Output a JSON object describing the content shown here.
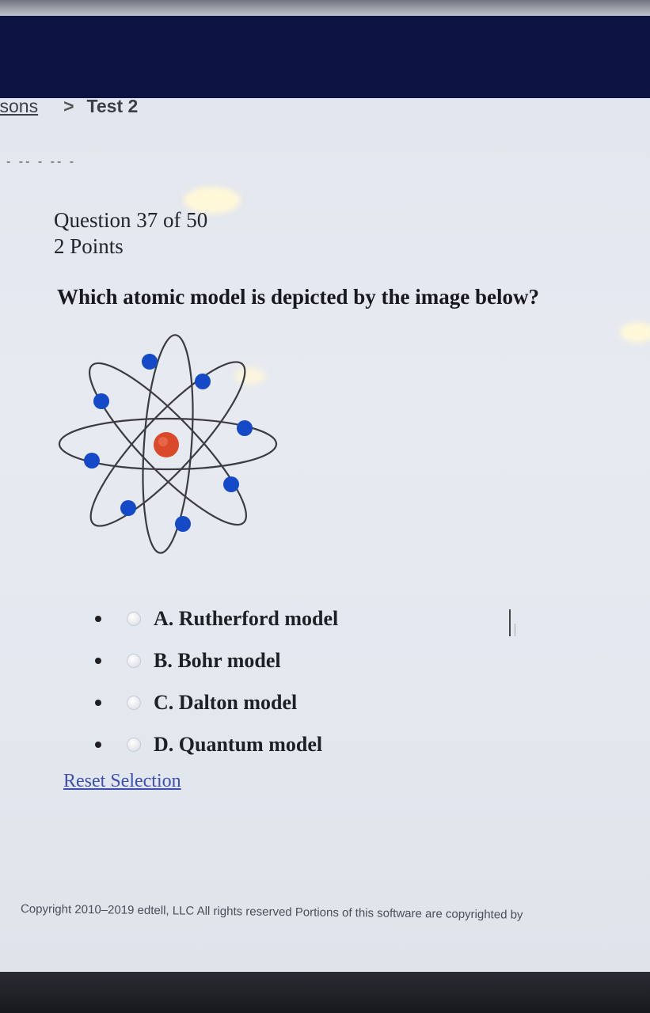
{
  "breadcrumb": {
    "parent": "ssons",
    "separator": ">",
    "current": "Test 2"
  },
  "question": {
    "progress": "Question 37 of 50",
    "points": "2 Points",
    "prompt": "Which atomic model is depicted by the image below?",
    "image_icon": "atom-diagram-icon"
  },
  "answers": [
    {
      "label": "A. Rutherford model",
      "selected": false
    },
    {
      "label": "B. Bohr model",
      "selected": false
    },
    {
      "label": "C. Dalton model",
      "selected": false
    },
    {
      "label": "D. Quantum model",
      "selected": false
    }
  ],
  "reset_label": "Reset Selection",
  "footer": {
    "copyright": "Copyright 2010–2019 edtell, LLC  All rights reserved  Portions of this software are copyrighted by"
  },
  "colors": {
    "header": "#0d1342",
    "electron": "#1449c8",
    "nucleus": "#d9492a",
    "link": "#3f4fb0"
  }
}
